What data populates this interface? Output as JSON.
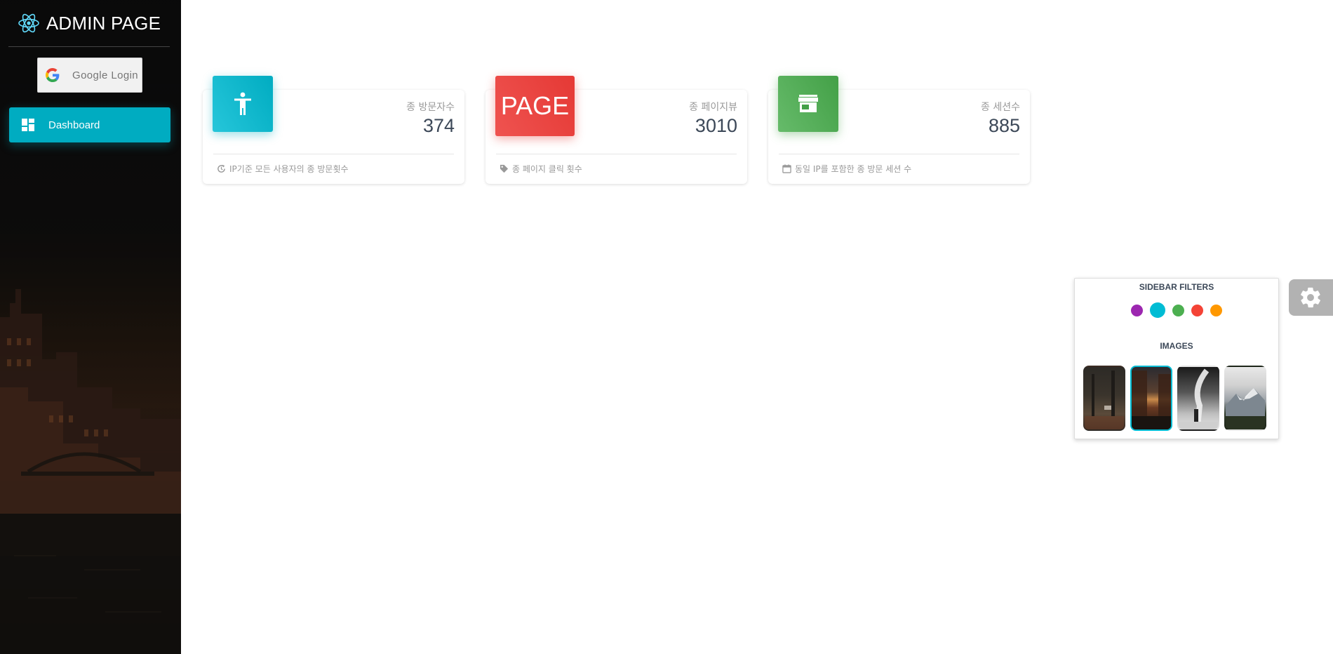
{
  "sidebar": {
    "brand": "ADMIN PAGE",
    "google_login": "Google Login",
    "nav": [
      {
        "label": "Dashboard",
        "icon": "dashboard-icon",
        "active": true
      }
    ]
  },
  "cards": [
    {
      "title": "종 방문자수",
      "value": "374",
      "footer": "IP기준 모든 사용자의 종 방문횟수",
      "icon": "accessibility-icon",
      "color": "#00acc1",
      "footer_icon": "update-icon"
    },
    {
      "title": "종 페이지뷰",
      "value": "3010",
      "footer": "종 페이지 클릭 횟수",
      "icon_text": "PAGE",
      "color": "#e53935",
      "footer_icon": "tag-icon"
    },
    {
      "title": "종 세션수",
      "value": "885",
      "footer": "동일 IP를 포함한 종 방문 세션 수",
      "icon": "store-icon",
      "color": "#43a047",
      "footer_icon": "calendar-icon"
    }
  ],
  "fixed_plugin": {
    "filters_title": "SIDEBAR FILTERS",
    "images_title": "IMAGES",
    "filter_colors": [
      "#9c27b0",
      "#00bcd4",
      "#4caf50",
      "#f44336",
      "#ff9800"
    ],
    "active_filter": 1,
    "active_image": 1
  }
}
